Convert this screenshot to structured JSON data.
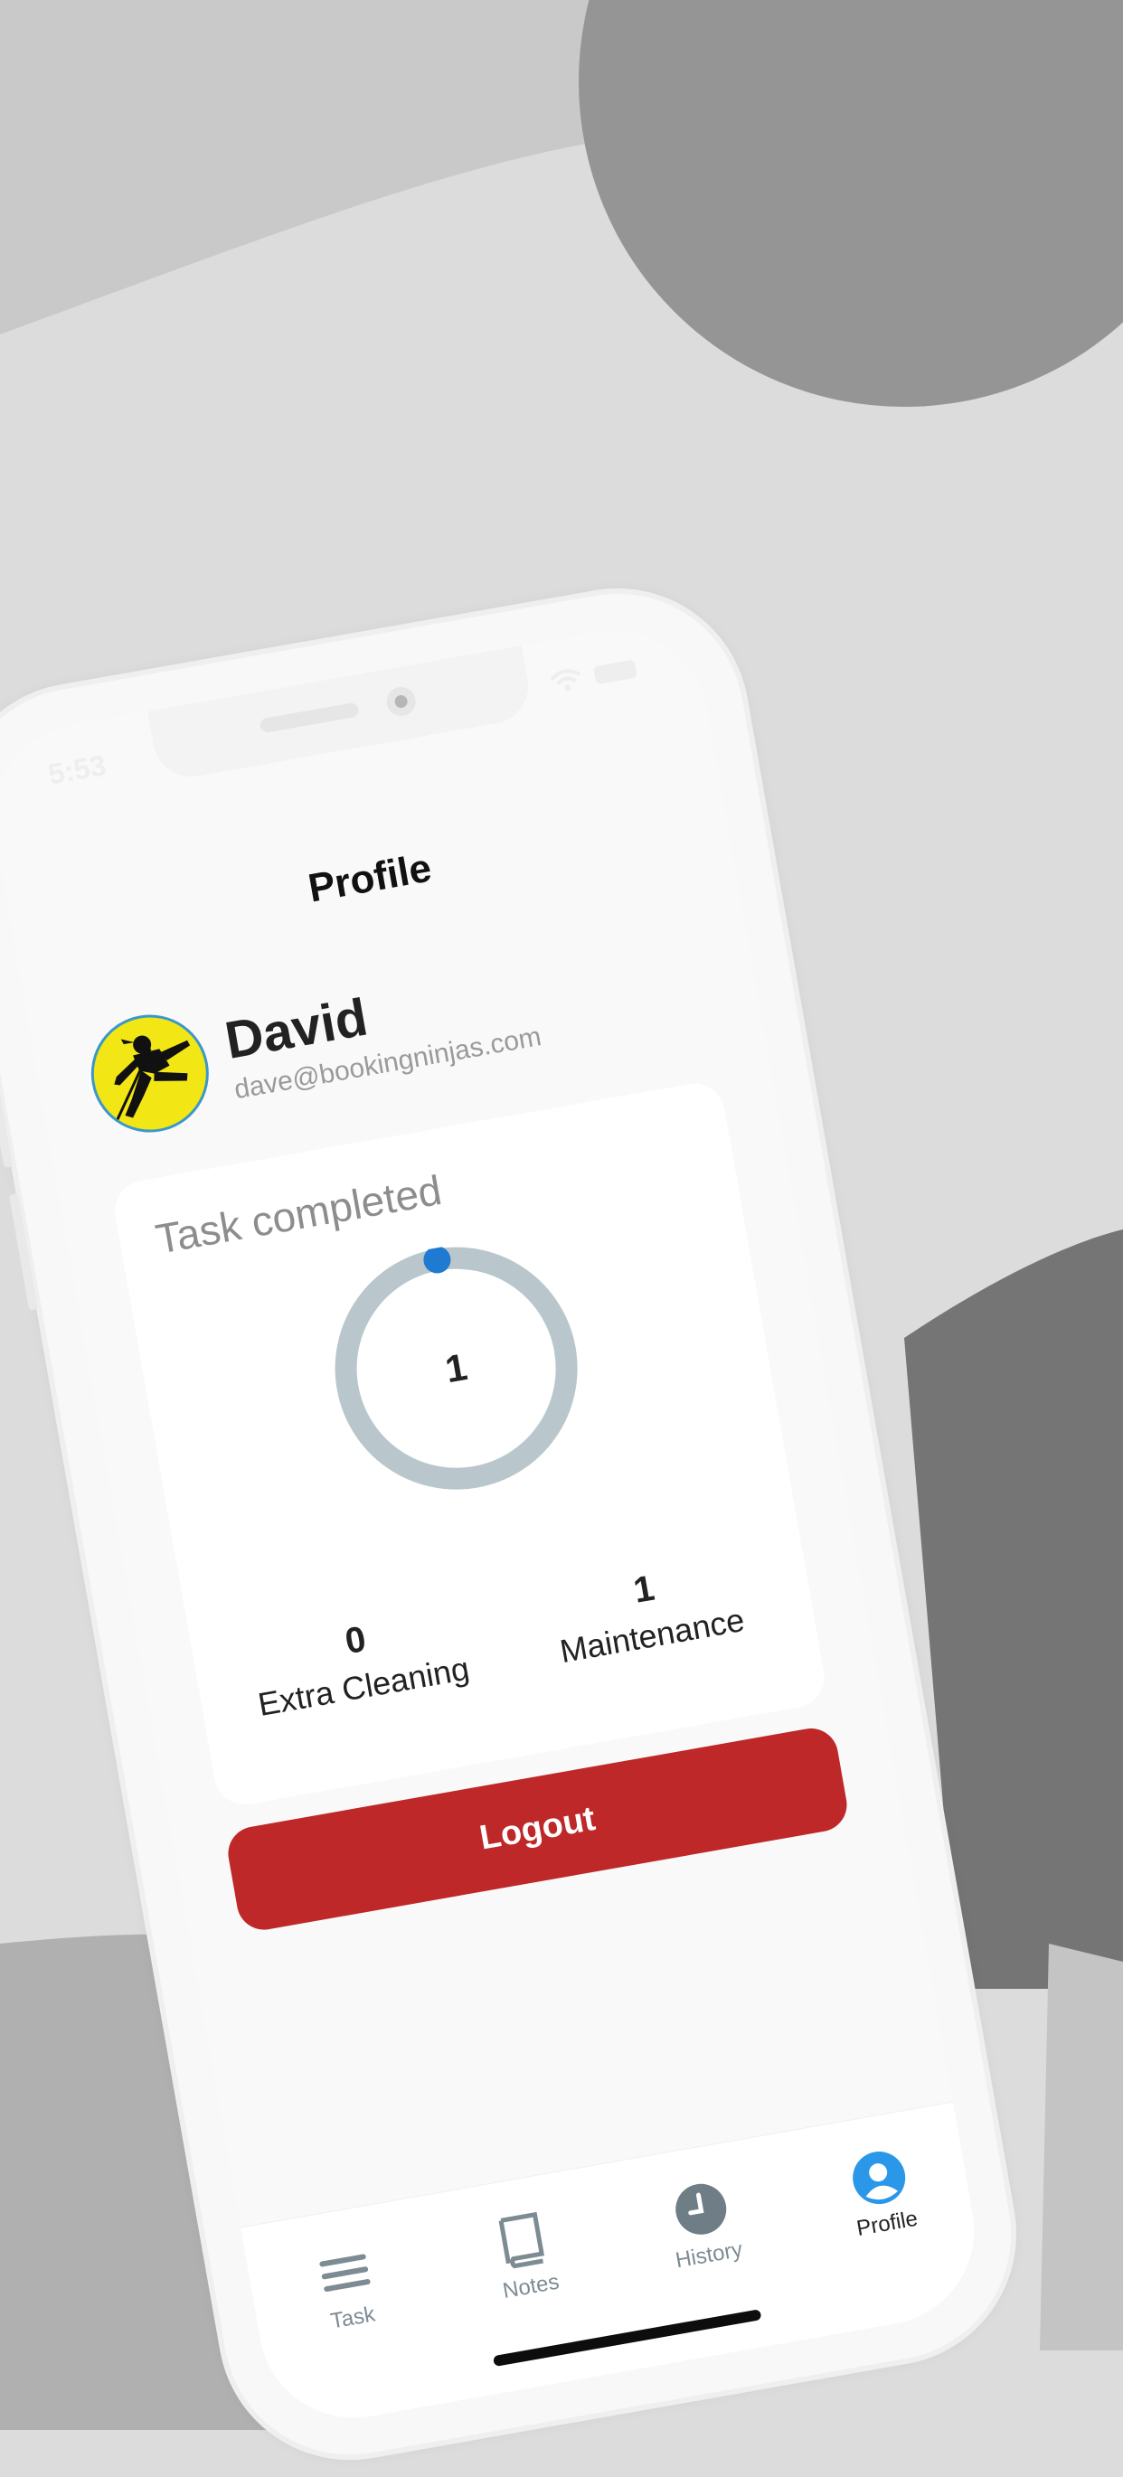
{
  "status_bar": {
    "time": "5:53"
  },
  "header": {
    "title": "Profile"
  },
  "user": {
    "name": "David",
    "email": "dave@bookingninjas.com"
  },
  "task_card": {
    "title": "Task completed",
    "total": "1",
    "progress_fraction": 0.0,
    "stats": [
      {
        "value": "0",
        "label": "Extra Cleaning"
      },
      {
        "value": "1",
        "label": "Maintenance"
      }
    ]
  },
  "actions": {
    "logout_label": "Logout"
  },
  "tabbar": {
    "items": [
      {
        "label": "Task",
        "icon": "menu-icon",
        "active": false
      },
      {
        "label": "Notes",
        "icon": "book-icon",
        "active": false
      },
      {
        "label": "History",
        "icon": "clock-icon",
        "active": false
      },
      {
        "label": "Profile",
        "icon": "user-icon",
        "active": true
      }
    ]
  },
  "colors": {
    "accent": "#1f7ad1",
    "logout": "#be2828",
    "ring": "#b9c7cc",
    "avatar_bg": "#f2e615"
  }
}
